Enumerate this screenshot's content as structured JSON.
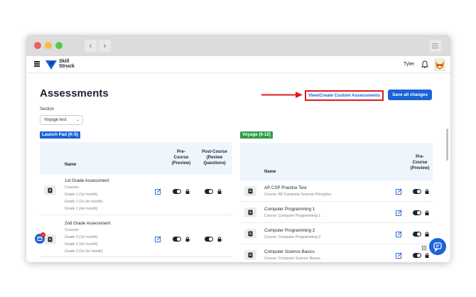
{
  "window": {
    "back_glyph": "‹",
    "forward_glyph": "›"
  },
  "app": {
    "logo_line1": "Skill",
    "logo_line2": "Struck",
    "user_name": "Tyler"
  },
  "page": {
    "title": "Assessments",
    "custom_button_label": "View/Create Custom Assessments",
    "save_button_label": "Save all changes",
    "section_label": "Section",
    "section_value": "Voyage test"
  },
  "launch_pad": {
    "badge": "Launch Pad (K-5)",
    "headers": {
      "name": "Name",
      "pre_line1": "Pre-",
      "pre_line2": "Course",
      "pre_line3": "(Preview)",
      "post_line1": "Post-Course",
      "post_line2": "(Review",
      "post_line3": "Questions)"
    },
    "rows": [
      {
        "title": "1st Grade Assessment",
        "courses_label": "Courses:",
        "courses": [
          "Grade 1 (1x/ month)",
          "Grade 1 (2x-3x/ month)",
          "Grade 1 (4x/ month)"
        ]
      },
      {
        "title": "2nd Grade Assessment",
        "courses_label": "Courses:",
        "courses": [
          "Grade 2 (1x/ month)",
          "Grade 2 (4x/ month)",
          "Grade 2 (2x-3x/ month)"
        ]
      }
    ]
  },
  "voyage": {
    "badge": "Voyage (6-12)",
    "headers": {
      "name": "Name",
      "pre_line1": "Pre-",
      "pre_line2": "Course",
      "pre_line3": "(Preview)"
    },
    "rows": [
      {
        "title": "AP CSP Practice Test",
        "course": "Course: AP Computer Science Principles"
      },
      {
        "title": "Computer Programming 1",
        "course": "Course: Computer Programming 1"
      },
      {
        "title": "Computer Programming 2",
        "course": "Course: Computer Programming 2"
      },
      {
        "title": "Computer Science Basics",
        "course": "Course: Computer Science Basics"
      }
    ]
  },
  "notification_count": "2",
  "colors": {
    "primary": "#1b63d9",
    "launch_badge": "#1b63d9",
    "voyage_badge": "#2f9e44",
    "highlight": "#e21b1b"
  },
  "icons": [
    "hamburger-icon",
    "bell-icon",
    "document-icon",
    "edit-icon",
    "lock-icon",
    "chat-icon"
  ]
}
